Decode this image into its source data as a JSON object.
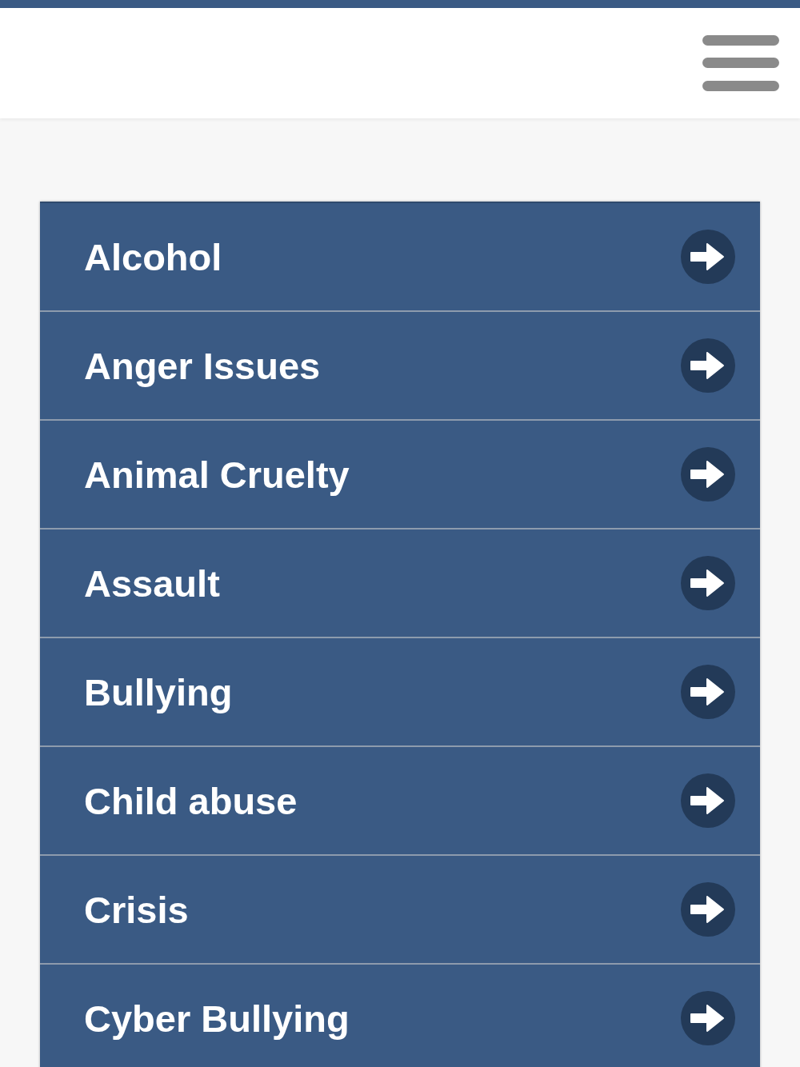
{
  "menu": {
    "items": [
      {
        "label": "Alcohol"
      },
      {
        "label": "Anger Issues"
      },
      {
        "label": "Animal Cruelty"
      },
      {
        "label": "Assault"
      },
      {
        "label": "Bullying"
      },
      {
        "label": "Child abuse"
      },
      {
        "label": "Crisis"
      },
      {
        "label": "Cyber Bullying"
      }
    ]
  }
}
